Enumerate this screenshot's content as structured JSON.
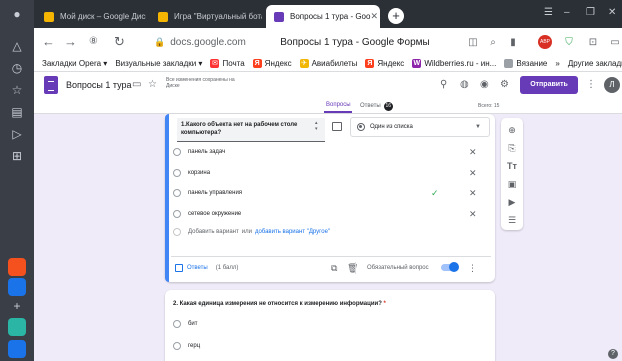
{
  "browser": {
    "tabs": [
      {
        "label": "Мой диск – Google Диск",
        "favicon_color": "#f4b400"
      },
      {
        "label": "Игра \"Виртуальный ботаник\"",
        "favicon_color": "#f4b400"
      },
      {
        "label": "Вопросы 1 тура - Goo",
        "favicon_color": "#673ab7"
      }
    ],
    "new_tab_icon": "plus-icon",
    "address": {
      "host": "docs.google.com",
      "page_title": "Вопросы 1 тура - Google Формы"
    },
    "bookmarks": [
      {
        "label": "Закладки Opera ▾"
      },
      {
        "label": "Визуальные закладки ▾"
      },
      {
        "label": "Почта",
        "color": "#ff3333",
        "mark": "✉"
      },
      {
        "label": "Яндекс",
        "color": "#fc3f1d",
        "mark": "Я"
      },
      {
        "label": "Авиабилеты",
        "color": "#f2b705",
        "mark": "✈"
      },
      {
        "label": "Яндекс",
        "color": "#fc3f1d",
        "mark": "Я"
      },
      {
        "label": "Wildberries.ru - ин...",
        "color": "#8e24aa",
        "mark": "W"
      },
      {
        "label": "Вязание",
        "color": "#9aa0a6",
        "mark": ""
      }
    ],
    "bookmarks_more": "»",
    "other_bookmarks": "Другие закладки ▾"
  },
  "form_header": {
    "title": "Вопросы 1 тура",
    "saved_text": "Все изменения сохранены на Диске",
    "send_label": "Отправить",
    "profile_letter": "Л"
  },
  "form_tabs": {
    "questions": "Вопросы",
    "answers": "Ответы",
    "answers_count": "16",
    "total": "Всего: 15"
  },
  "question1": {
    "text": "1.Какого объекта нет на рабочем столе компьютера?",
    "type_label": "Один из списка",
    "options": [
      {
        "label": "панель задач",
        "correct": false
      },
      {
        "label": "корзина",
        "correct": false
      },
      {
        "label": "панель управления",
        "correct": true
      },
      {
        "label": "сетевое окружение",
        "correct": false
      }
    ],
    "add_option": "Добавить вариант",
    "add_or": "или",
    "add_other": "добавить вариант \"Другое\"",
    "answers_label": "Ответы",
    "points": "(1 балл)",
    "required_label": "Обязательный вопрос",
    "required_on": true
  },
  "question2": {
    "text": "2. Какая единица измерения не относится к измерению информации?",
    "required_mark": "*",
    "options": [
      "бит",
      "герц"
    ]
  },
  "colors": {
    "form_accent": "#673ab7",
    "active_question": "#4285f4",
    "correct": "#34a853"
  }
}
